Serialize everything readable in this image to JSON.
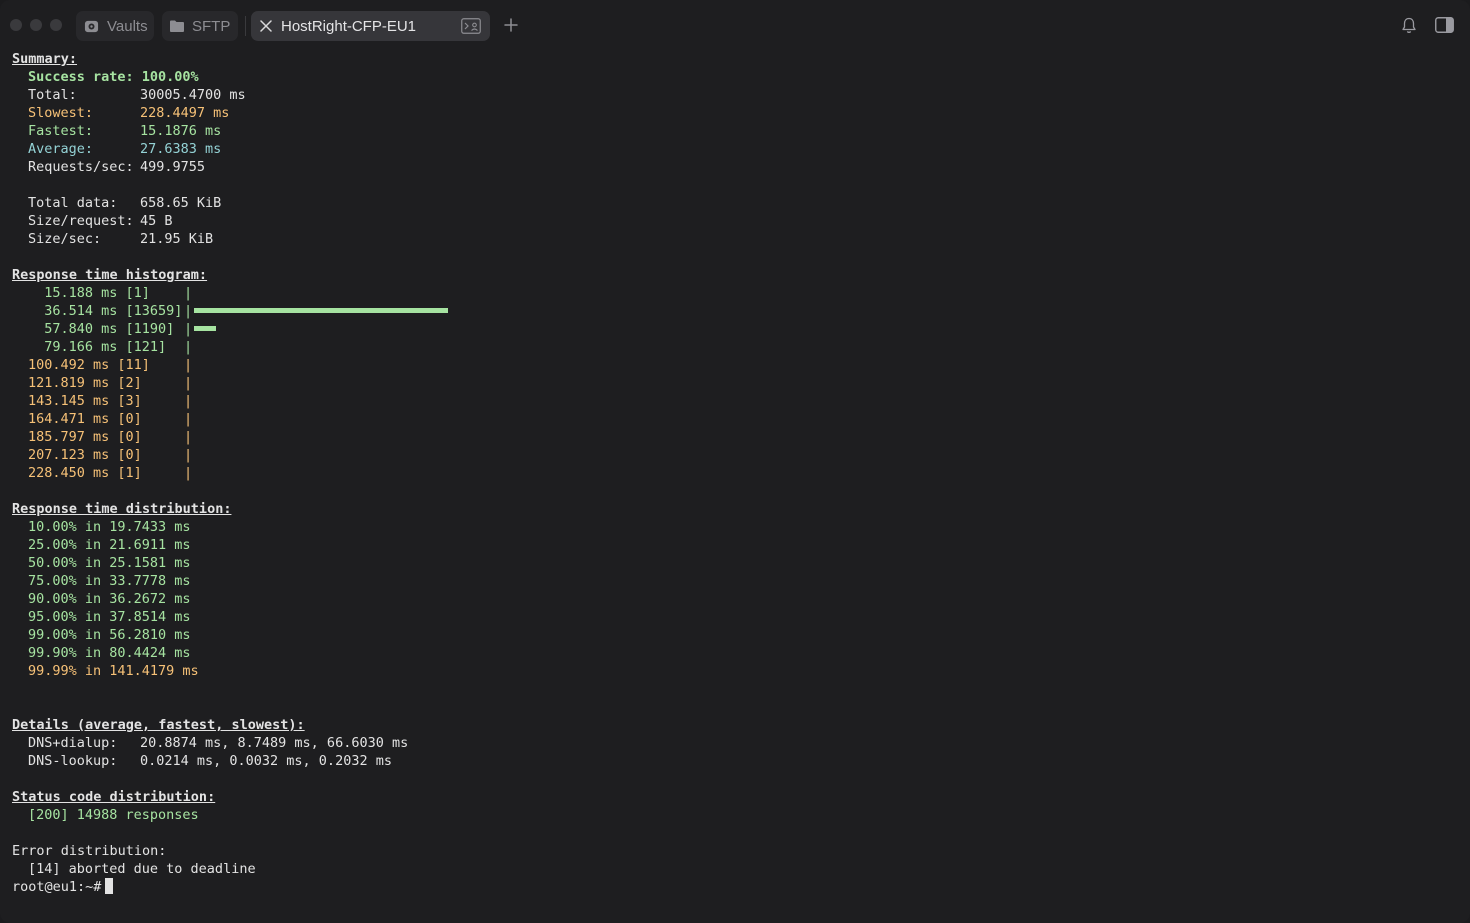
{
  "tabs": [
    {
      "label": "Vaults",
      "icon": "vault-icon"
    },
    {
      "label": "SFTP",
      "icon": "folder-icon"
    },
    {
      "label": "HostRight-CFP-EU1",
      "icon": "close-icon",
      "active": true
    }
  ],
  "colors": {
    "green": "#a6e3a1",
    "orange": "#f6c177",
    "teal": "#94d2d5",
    "text": "#e3e3e3",
    "background": "#1e1e20"
  },
  "summary": {
    "heading": "Summary:",
    "success_rate": "Success rate: 100.00%",
    "total": {
      "label": "Total:",
      "value": "30005.4700 ms"
    },
    "slowest": {
      "label": "Slowest:",
      "value": "228.4497 ms"
    },
    "fastest": {
      "label": "Fastest:",
      "value": "15.1876 ms"
    },
    "average": {
      "label": "Average:",
      "value": "27.6383 ms"
    },
    "rps": {
      "label": "Requests/sec:",
      "value": "499.9755"
    },
    "total_data": {
      "label": "Total data:",
      "value": "658.65 KiB"
    },
    "size_request": {
      "label": "Size/request:",
      "value": "45 B"
    },
    "size_sec": {
      "label": "Size/sec:",
      "value": "21.95 KiB"
    }
  },
  "histogram": {
    "heading": "Response time histogram:",
    "rows": [
      {
        "label": "  15.188 ms [1]     ",
        "count": 1,
        "color": "green"
      },
      {
        "label": "  36.514 ms [13659] ",
        "count": 13659,
        "color": "green"
      },
      {
        "label": "  57.840 ms [1190]  ",
        "count": 1190,
        "color": "green"
      },
      {
        "label": "  79.166 ms [121]   ",
        "count": 121,
        "color": "green"
      },
      {
        "label": "100.492 ms [11]    ",
        "count": 11,
        "color": "orange"
      },
      {
        "label": "121.819 ms [2]     ",
        "count": 2,
        "color": "orange"
      },
      {
        "label": "143.145 ms [3]     ",
        "count": 3,
        "color": "orange"
      },
      {
        "label": "164.471 ms [0]     ",
        "count": 0,
        "color": "orange"
      },
      {
        "label": "185.797 ms [0]     ",
        "count": 0,
        "color": "orange"
      },
      {
        "label": "207.123 ms [0]     ",
        "count": 0,
        "color": "orange"
      },
      {
        "label": "228.450 ms [1]     ",
        "count": 1,
        "color": "orange"
      }
    ]
  },
  "distribution": {
    "heading": "Response time distribution:",
    "rows": [
      {
        "text": "10.00% in 19.7433 ms",
        "color": "green"
      },
      {
        "text": "25.00% in 21.6911 ms",
        "color": "green"
      },
      {
        "text": "50.00% in 25.1581 ms",
        "color": "green"
      },
      {
        "text": "75.00% in 33.7778 ms",
        "color": "green"
      },
      {
        "text": "90.00% in 36.2672 ms",
        "color": "green"
      },
      {
        "text": "95.00% in 37.8514 ms",
        "color": "green"
      },
      {
        "text": "99.00% in 56.2810 ms",
        "color": "green"
      },
      {
        "text": "99.90% in 80.4424 ms",
        "color": "green"
      },
      {
        "text": "99.99% in 141.4179 ms",
        "color": "orange"
      }
    ]
  },
  "details": {
    "heading": "Details (average, fastest, slowest):",
    "dns_dialup": {
      "label": "DNS+dialup:",
      "value": "20.8874 ms, 8.7489 ms, 66.6030 ms"
    },
    "dns_lookup": {
      "label": "DNS-lookup:",
      "value": "0.0214 ms, 0.0032 ms, 0.2032 ms"
    }
  },
  "status_codes": {
    "heading": "Status code distribution:",
    "rows": [
      "[200] 14988 responses"
    ]
  },
  "errors": {
    "heading": "Error distribution:",
    "rows": [
      "[14] aborted due to deadline"
    ]
  },
  "prompt": "root@eu1:~#"
}
